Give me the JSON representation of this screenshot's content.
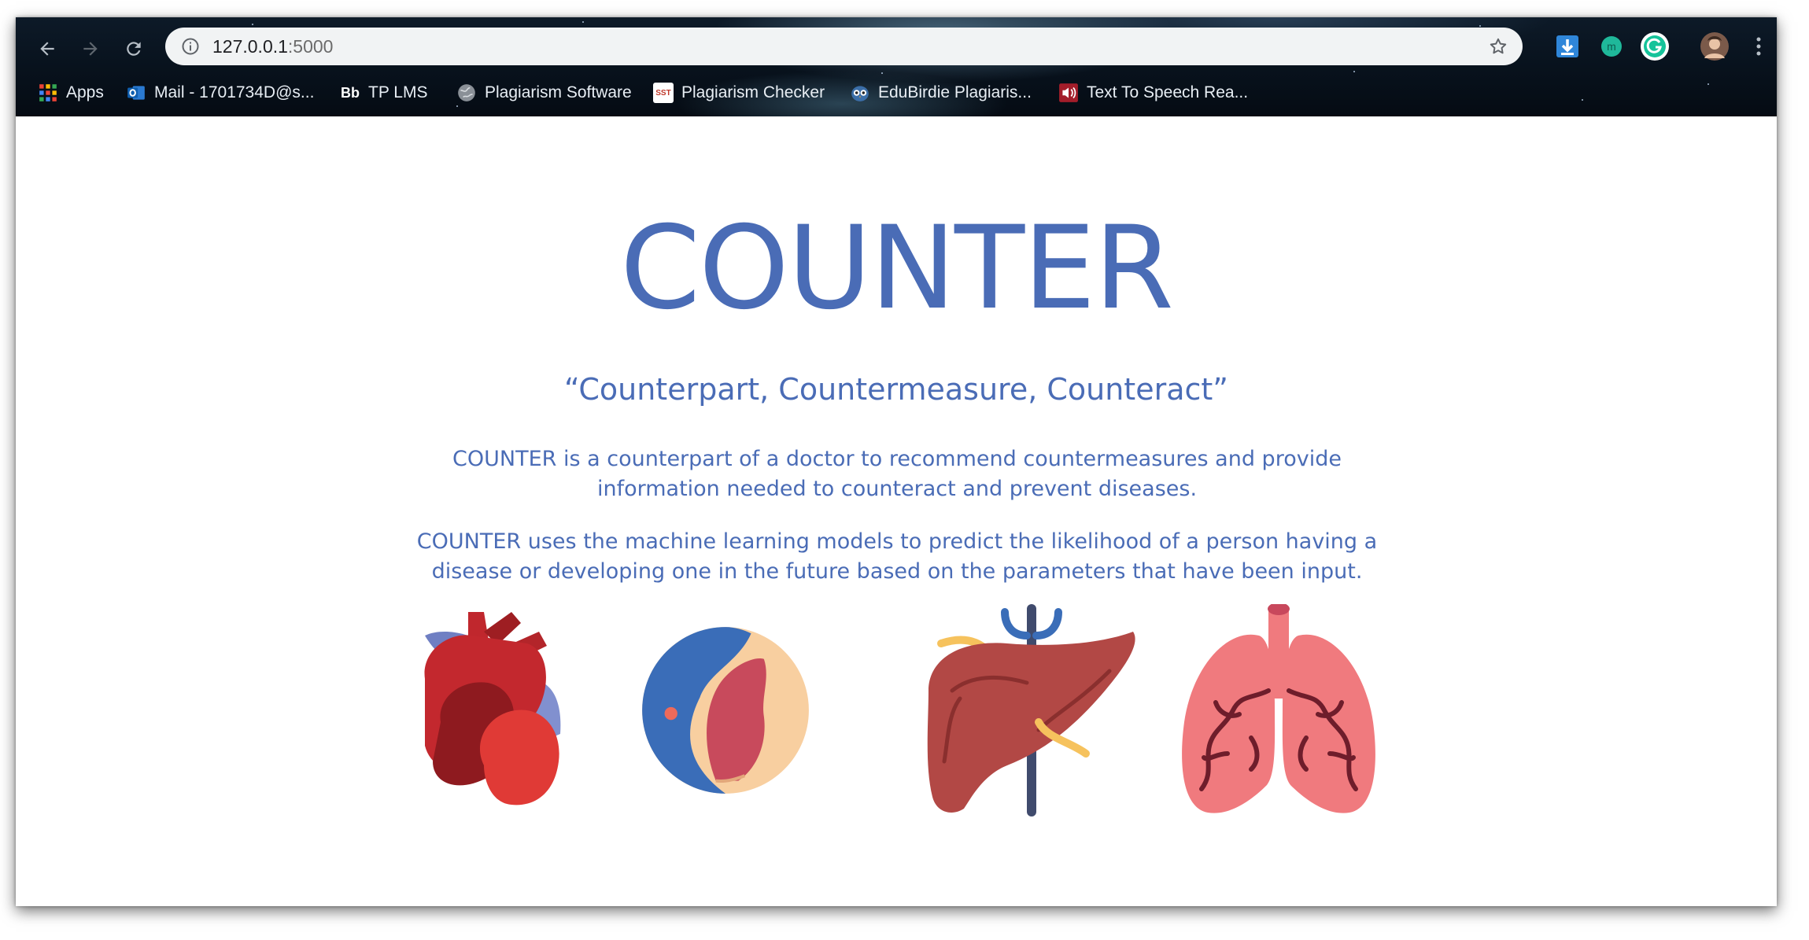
{
  "browser": {
    "url_host": "127.0.0.1",
    "url_port": ":5000",
    "bookmarks": [
      {
        "label": "Apps",
        "icon": "apps-grid-icon"
      },
      {
        "label": "Mail - 1701734D@s...",
        "icon": "outlook-icon"
      },
      {
        "label": "TP LMS",
        "icon": "blackboard-icon",
        "icon_text": "Bb"
      },
      {
        "label": "Plagiarism Software",
        "icon": "globe-icon"
      },
      {
        "label": "Plagiarism Checker",
        "icon": "sst-icon",
        "icon_text": "SST"
      },
      {
        "label": "EduBirdie Plagiaris...",
        "icon": "owl-icon"
      },
      {
        "label": "Text To Speech Rea...",
        "icon": "speaker-icon"
      }
    ],
    "extensions": [
      "download-extension-icon",
      "mint-extension-icon",
      "grammarly-icon",
      "profile-avatar",
      "more-menu-icon"
    ],
    "colors": {
      "toolbar_bg": "#0b1622",
      "omnibox_bg": "#f1f3f4"
    }
  },
  "page": {
    "title": "COUNTER",
    "tagline": "“Counterpart, Countermeasure, Counteract”",
    "paragraph1": "COUNTER is a counterpart of a doctor to recommend countermeasures and provide information needed to counteract and prevent diseases.",
    "paragraph2": "COUNTER uses the machine learning models to predict the likelihood of a person having a disease or developing one in the future based on the parameters that have been input.",
    "organs": [
      "heart-icon",
      "pancreas-icon",
      "liver-icon",
      "lungs-icon"
    ],
    "colors": {
      "text": "#4a6cb6",
      "background": "#ffffff"
    }
  }
}
